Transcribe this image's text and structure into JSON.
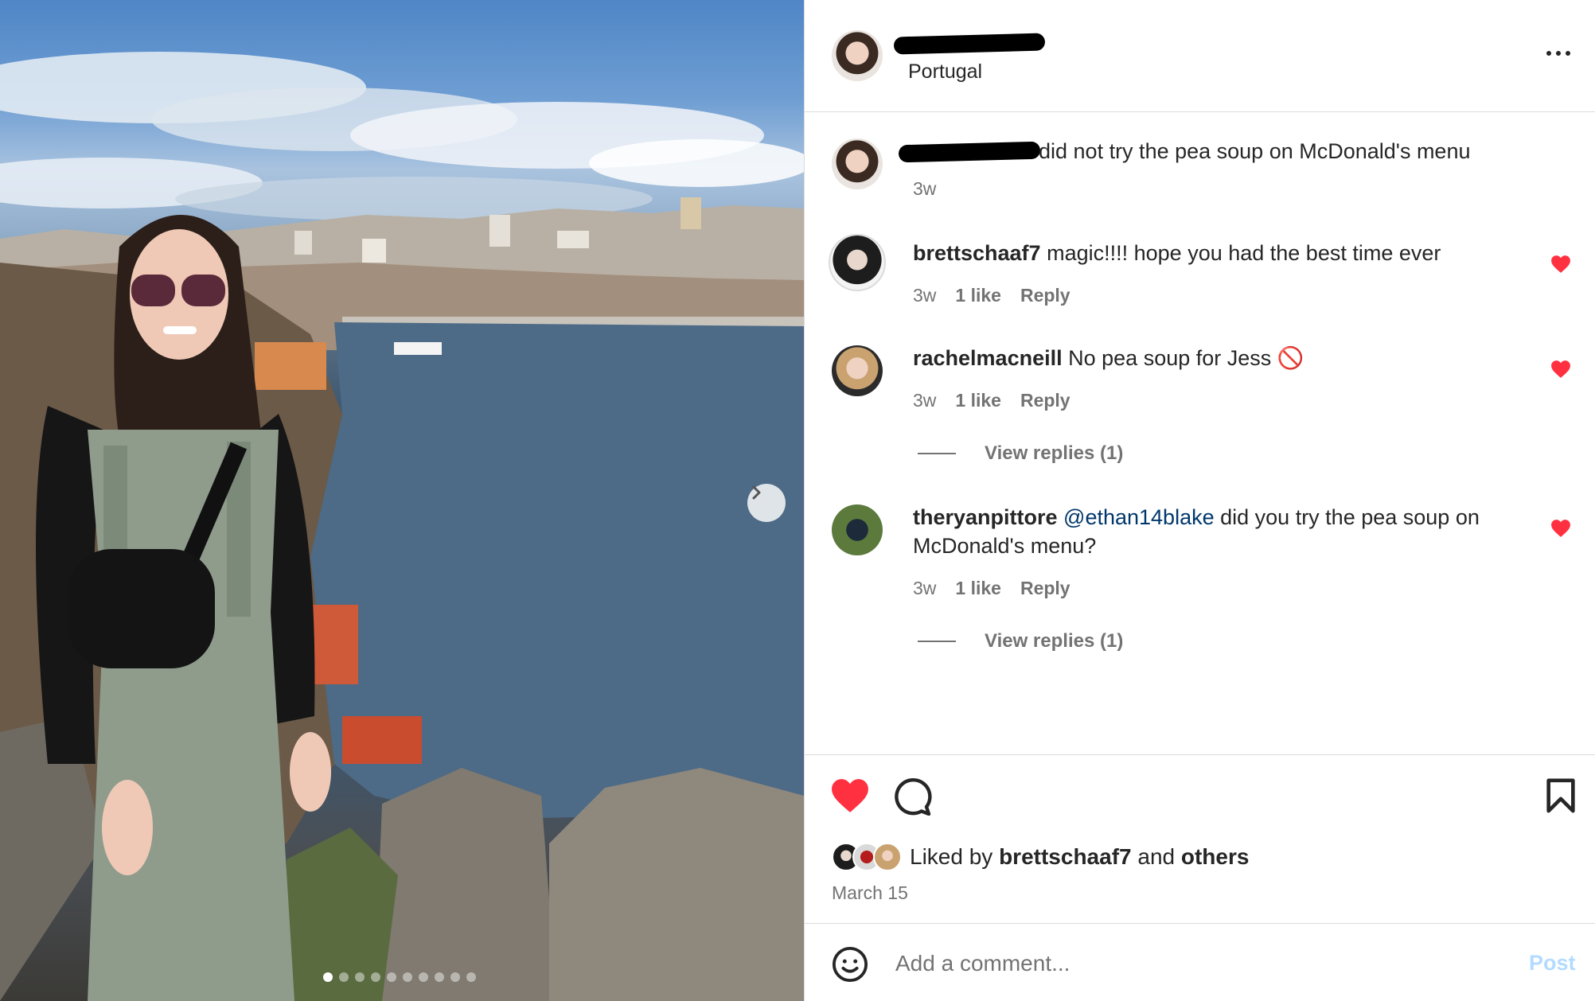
{
  "post": {
    "location": "Portugal",
    "caption": "did not try the pea soup on McDonald's menu",
    "caption_time": "3w",
    "slide_count": 10,
    "active_slide": 1
  },
  "comments": [
    {
      "username": "brettschaaf7",
      "text": "magic!!!! hope you had the best time ever",
      "time": "3w",
      "likes": "1 like",
      "reply": "Reply"
    },
    {
      "username": "rachelmacneill",
      "text": "No pea soup for Jess 🚫",
      "time": "3w",
      "likes": "1 like",
      "reply": "Reply",
      "view_replies": "View replies (1)"
    },
    {
      "username": "theryanpittore",
      "mention": "@ethan14blake",
      "text_line1": "did you try the pea soup on",
      "text_line2": "McDonald's menu?",
      "time": "3w",
      "likes": "1 like",
      "reply": "Reply",
      "view_replies": "View replies (1)"
    }
  ],
  "likes": {
    "prefix": "Liked by",
    "user": "brettschaaf7",
    "middle": "and",
    "suffix": "others",
    "date": "March 15"
  },
  "composer": {
    "placeholder": "Add a comment...",
    "post_label": "Post"
  },
  "colors": {
    "heart": "#ff3040",
    "post_disabled": "#b3dbff",
    "mention": "#00376b"
  },
  "icons": [
    "next-arrow-icon",
    "more-options-icon",
    "heart-icon",
    "comment-icon",
    "bookmark-icon",
    "emoji-icon"
  ]
}
